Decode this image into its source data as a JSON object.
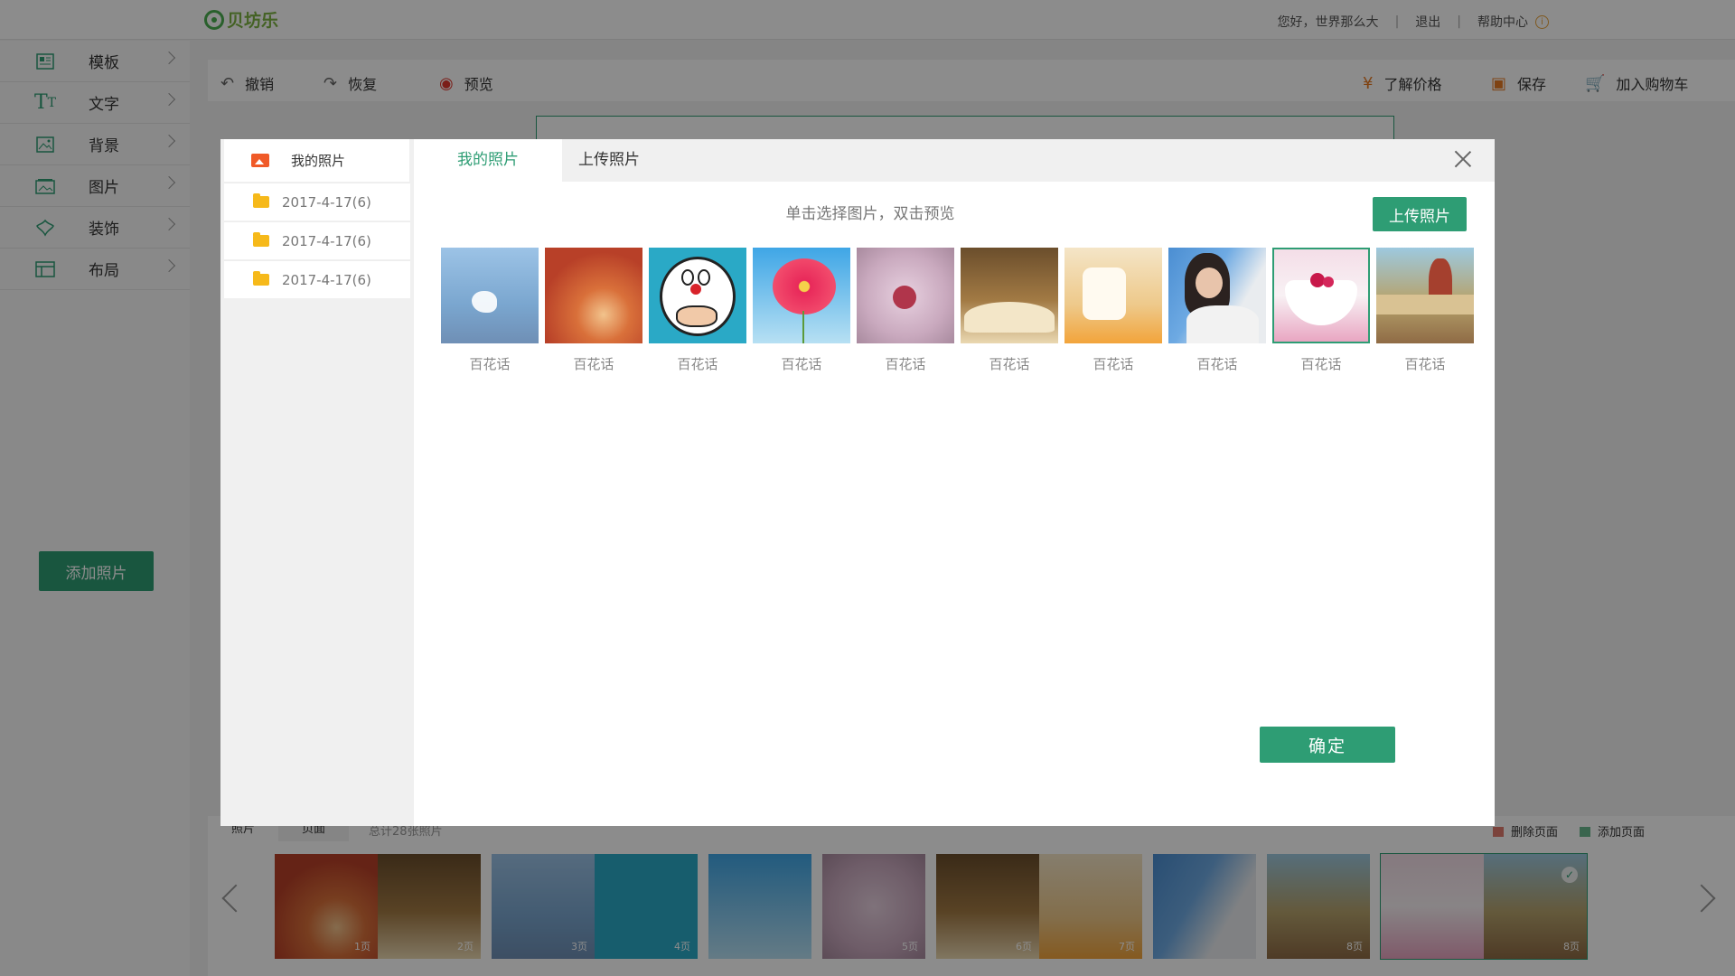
{
  "topbar": {
    "logo_text": "贝坊乐",
    "greeting": "您好，世界那么大",
    "logout": "退出",
    "help": "帮助中心"
  },
  "sidebar": {
    "items": [
      {
        "label": "模板",
        "icon": "template-icon"
      },
      {
        "label": "文字",
        "icon": "text-icon"
      },
      {
        "label": "背景",
        "icon": "background-icon"
      },
      {
        "label": "图片",
        "icon": "image-icon"
      },
      {
        "label": "装饰",
        "icon": "decoration-icon"
      },
      {
        "label": "布局",
        "icon": "layout-icon"
      }
    ],
    "add_photo": "添加照片"
  },
  "toolbar": {
    "undo": "撤销",
    "redo": "恢复",
    "preview": "预览",
    "price": "了解价格",
    "save": "保存",
    "cart": "加入购物车"
  },
  "bottom": {
    "tabs": [
      "照片",
      "页面"
    ],
    "count": "总计28张照片",
    "delete_page": "删除页面",
    "add_page": "添加页面",
    "pages": [
      "1页",
      "2页",
      "3页",
      "4页",
      "5页",
      "6页",
      "7页",
      "8页",
      "8页"
    ]
  },
  "modal": {
    "left_title": "我的照片",
    "folders": [
      "2017-4-17(6)",
      "2017-4-17(6)",
      "2017-4-17(6)"
    ],
    "tabs": [
      "我的照片",
      "上传照片"
    ],
    "hint": "单击选择图片，双击预览",
    "upload_button": "上传照片",
    "photos": [
      "百花话",
      "百花话",
      "百花话",
      "百花话",
      "百花话",
      "百花话",
      "百花话",
      "百花话",
      "百花话",
      "百花话"
    ],
    "selected_index": 8,
    "confirm": "确定"
  },
  "colors": {
    "accent": "#2e9d74",
    "folder": "#f6b91a",
    "photo_icon": "#f05a28"
  }
}
